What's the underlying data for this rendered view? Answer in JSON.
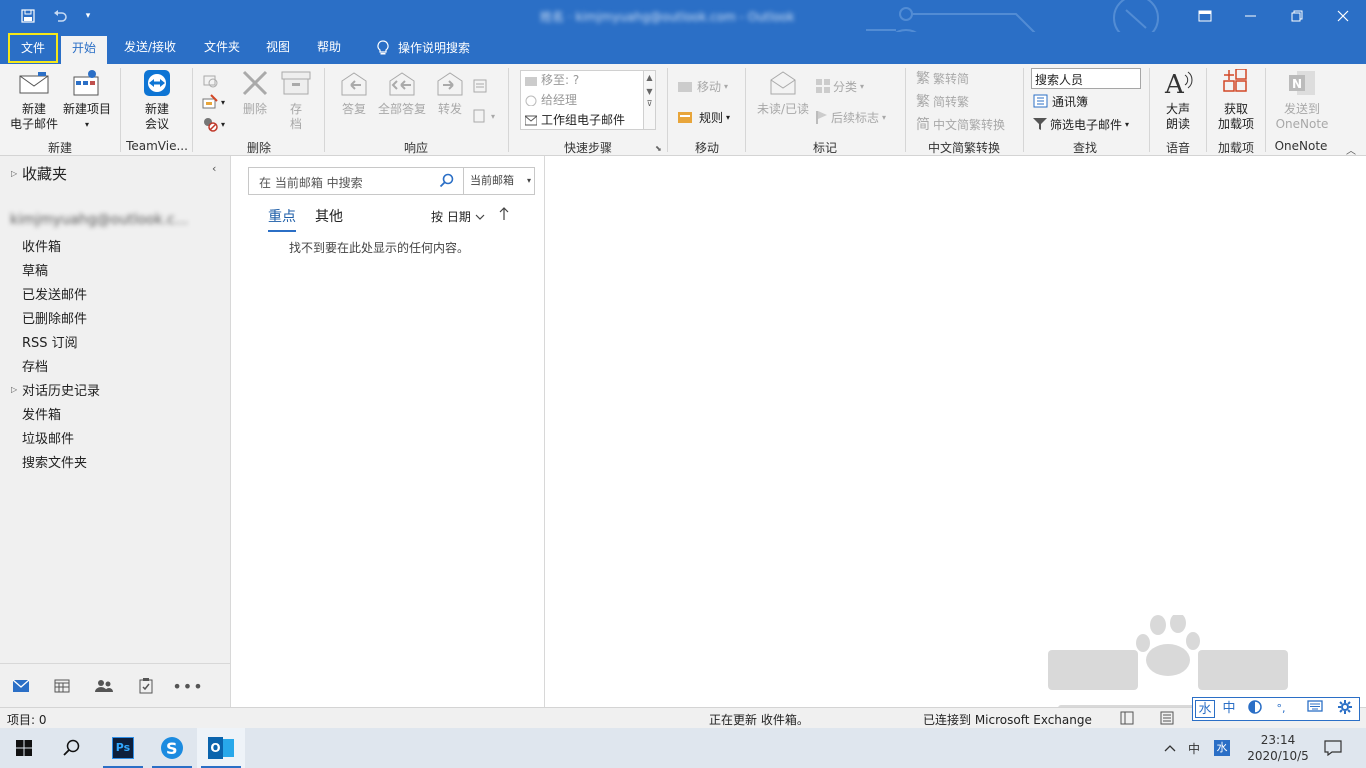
{
  "titlebar": {
    "title_blurred": "姓名 · kimjmyuahg@outlook.com - Outlook",
    "restore_label": "⧉",
    "maximize_label": "□",
    "close_label": "✕"
  },
  "tabs": [
    {
      "label": "文件"
    },
    {
      "label": "开始"
    },
    {
      "label": "发送/接收"
    },
    {
      "label": "文件夹"
    },
    {
      "label": "视图"
    },
    {
      "label": "帮助"
    },
    {
      "label": "操作说明搜索"
    }
  ],
  "ribbon": {
    "new_email": "新建\n电子邮件",
    "new_email_l1": "新建",
    "new_email_l2": "电子邮件",
    "new_item_l1": "新建项目",
    "group_new": "新建",
    "new_meeting_l1": "新建",
    "new_meeting_l2": "会议",
    "group_teamviewer": "TeamVie...",
    "delete_label": "删除",
    "archive_l1": "存",
    "archive_l2": "档",
    "group_delete": "删除",
    "reply": "答复",
    "reply_all": "全部答复",
    "forward": "转发",
    "group_respond": "响应",
    "quick_steps": [
      "移至: ?",
      "给经理",
      "工作组电子邮件"
    ],
    "group_quicksteps": "快速步骤",
    "move": "移动",
    "rules": "规则",
    "group_move": "移动",
    "unread_read": "未读/已读",
    "categorize": "分类",
    "followup": "后续标志",
    "group_tags": "标记",
    "trad_to_simp": "繁转简",
    "simp_to_trad": "简转繁",
    "chinese_convert": "中文简繁转换",
    "group_chinese": "中文简繁转换",
    "search_people": "搜索人员",
    "address_book": "通讯簿",
    "filter_email": "筛选电子邮件",
    "group_find": "查找",
    "read_aloud_l1": "大声",
    "read_aloud_l2": "朗读",
    "group_speech": "语音",
    "get_addins_l1": "获取",
    "get_addins_l2": "加载项",
    "group_addins": "加载项",
    "onenote_l1": "发送到",
    "onenote_l2": "OneNote",
    "group_onenote": "OneNote"
  },
  "nav": {
    "favorites": "收藏夹",
    "account_blurred": "kimjmyuahg@outlook.c...",
    "folders": [
      "收件箱",
      "草稿",
      "已发送邮件",
      "已删除邮件",
      "RSS 订阅",
      "存档",
      "对话历史记录",
      "发件箱",
      "垃圾邮件",
      "搜索文件夹"
    ]
  },
  "msglist": {
    "search_placeholder": "在 当前邮箱 中搜索",
    "scope": "当前邮箱",
    "tab_focused": "重点",
    "tab_other": "其他",
    "sort": "按 日期",
    "empty": "找不到要在此处显示的任何内容。"
  },
  "status": {
    "items": "项目: 0",
    "updating": "正在更新 收件箱。",
    "connected": "已连接到 Microsoft Exchange"
  },
  "ime": {
    "mode": "中",
    "punct": "°,"
  },
  "taskbar": {
    "ps_label": "Ps",
    "outlook_label": "O",
    "lang": "中",
    "ime": "水",
    "time": "23:14",
    "date": "2020/10/5"
  },
  "colors": {
    "accent": "#2b6fc6",
    "highlight": "#f5e81a"
  }
}
